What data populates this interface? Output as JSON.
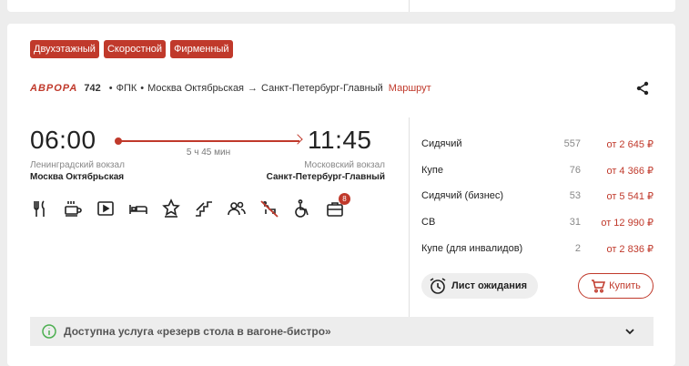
{
  "tags": [
    "Двухэтажный",
    "Скоростной",
    "Фирменный"
  ],
  "train": {
    "logo": "АВРОРА",
    "number": "742",
    "carrier": "ФПК",
    "from": "Москва Октябрьская",
    "to": "Санкт-Петербург-Главный",
    "route_link": "Маршрут"
  },
  "departure": {
    "time": "06:00",
    "station_sub": "Ленинградский вокзал",
    "station_main": "Москва Октябрьская"
  },
  "arrival": {
    "time": "11:45",
    "station_sub": "Московский вокзал",
    "station_main": "Санкт-Петербург-Главный"
  },
  "duration": "5 ч 45 мин",
  "amenities": [
    {
      "icon": "restaurant-icon"
    },
    {
      "icon": "coffee-icon"
    },
    {
      "icon": "video-icon"
    },
    {
      "icon": "bed-icon"
    },
    {
      "icon": "star-icon"
    },
    {
      "icon": "stairs-icon"
    },
    {
      "icon": "passengers-icon"
    },
    {
      "icon": "no-pets-icon"
    },
    {
      "icon": "wheelchair-icon"
    },
    {
      "icon": "lunchbox-icon",
      "badge": "8"
    }
  ],
  "seats": [
    {
      "class": "Сидячий",
      "count": "557",
      "price": "от 2 645 ₽"
    },
    {
      "class": "Купе",
      "count": "76",
      "price": "от 4 366 ₽"
    },
    {
      "class": "Сидячий (бизнес)",
      "count": "53",
      "price": "от 5 541 ₽"
    },
    {
      "class": "СВ",
      "count": "31",
      "price": "от 12 990 ₽"
    },
    {
      "class": "Купе (для инвалидов)",
      "count": "2",
      "price": "от 2 836 ₽"
    }
  ],
  "buttons": {
    "waitlist": "Лист ожидания",
    "buy": "Купить"
  },
  "service_notice": "Доступна услуга «резерв стола в вагоне-бистро»",
  "colors": {
    "accent": "#c0392b",
    "text": "#222222",
    "muted": "#888888"
  }
}
